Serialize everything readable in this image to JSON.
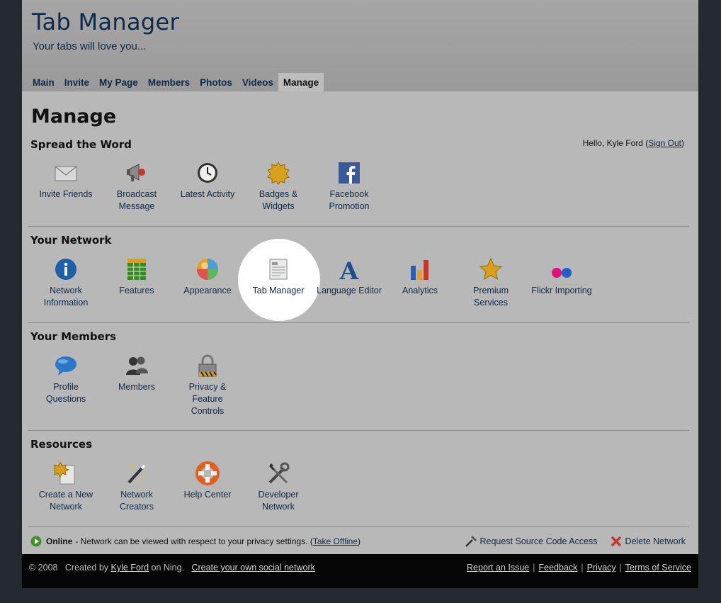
{
  "header": {
    "title": "Tab Manager",
    "tagline": "Your tabs will love you..."
  },
  "tabs": [
    {
      "label": "Main"
    },
    {
      "label": "Invite"
    },
    {
      "label": "My Page"
    },
    {
      "label": "Members"
    },
    {
      "label": "Photos"
    },
    {
      "label": "Videos"
    },
    {
      "label": "Manage",
      "active": true
    }
  ],
  "page": {
    "title": "Manage",
    "greeting_prefix": "Hello, Kyle Ford (",
    "sign_out": "Sign Out",
    "greeting_suffix": ")"
  },
  "sections": {
    "spread": {
      "title": "Spread the Word",
      "items": [
        {
          "label": "Invite Friends",
          "icon": "envelope-icon"
        },
        {
          "label": "Broadcast Message",
          "icon": "megaphone-icon"
        },
        {
          "label": "Latest Activity",
          "icon": "clock-icon"
        },
        {
          "label": "Badges & Widgets",
          "icon": "badge-icon"
        },
        {
          "label": "Facebook Promotion",
          "icon": "facebook-icon"
        }
      ]
    },
    "network": {
      "title": "Your Network",
      "items": [
        {
          "label": "Network Information",
          "icon": "info-icon"
        },
        {
          "label": "Features",
          "icon": "grid-icon"
        },
        {
          "label": "Appearance",
          "icon": "color-wheel-icon"
        },
        {
          "label": "Tab Manager",
          "icon": "document-icon"
        },
        {
          "label": "Language Editor",
          "icon": "letter-a-icon"
        },
        {
          "label": "Analytics",
          "icon": "bar-chart-icon"
        },
        {
          "label": "Premium Services",
          "icon": "star-icon"
        },
        {
          "label": "Flickr Importing",
          "icon": "flickr-icon"
        }
      ]
    },
    "members": {
      "title": "Your Members",
      "items": [
        {
          "label": "Profile Questions",
          "icon": "speech-bubble-icon"
        },
        {
          "label": "Members",
          "icon": "people-icon"
        },
        {
          "label": "Privacy & Feature Controls",
          "icon": "lock-icon"
        }
      ]
    },
    "resources": {
      "title": "Resources",
      "items": [
        {
          "label": "Create a New Network",
          "icon": "new-network-icon"
        },
        {
          "label": "Network Creators",
          "icon": "magic-wand-icon"
        },
        {
          "label": "Help Center",
          "icon": "life-ring-icon"
        },
        {
          "label": "Developer Network",
          "icon": "tools-icon"
        }
      ]
    }
  },
  "status": {
    "state": "Online",
    "message": " - Network can be viewed with respect to your privacy settings. (",
    "take_offline": "Take Offline",
    "close": ")",
    "request_source": "Request Source Code Access",
    "delete_network": "Delete Network"
  },
  "footer": {
    "copyright": "© 2008   Created by ",
    "creator": "Kyle Ford",
    "on_ning": " on Ning.   ",
    "create_own": "Create your own social network",
    "links": [
      "Report an Issue",
      "Feedback",
      "Privacy",
      "Terms of Service"
    ]
  },
  "colors": {
    "link": "#0d2a4a",
    "online": "#3f8f2a",
    "delete": "#c0392b"
  }
}
